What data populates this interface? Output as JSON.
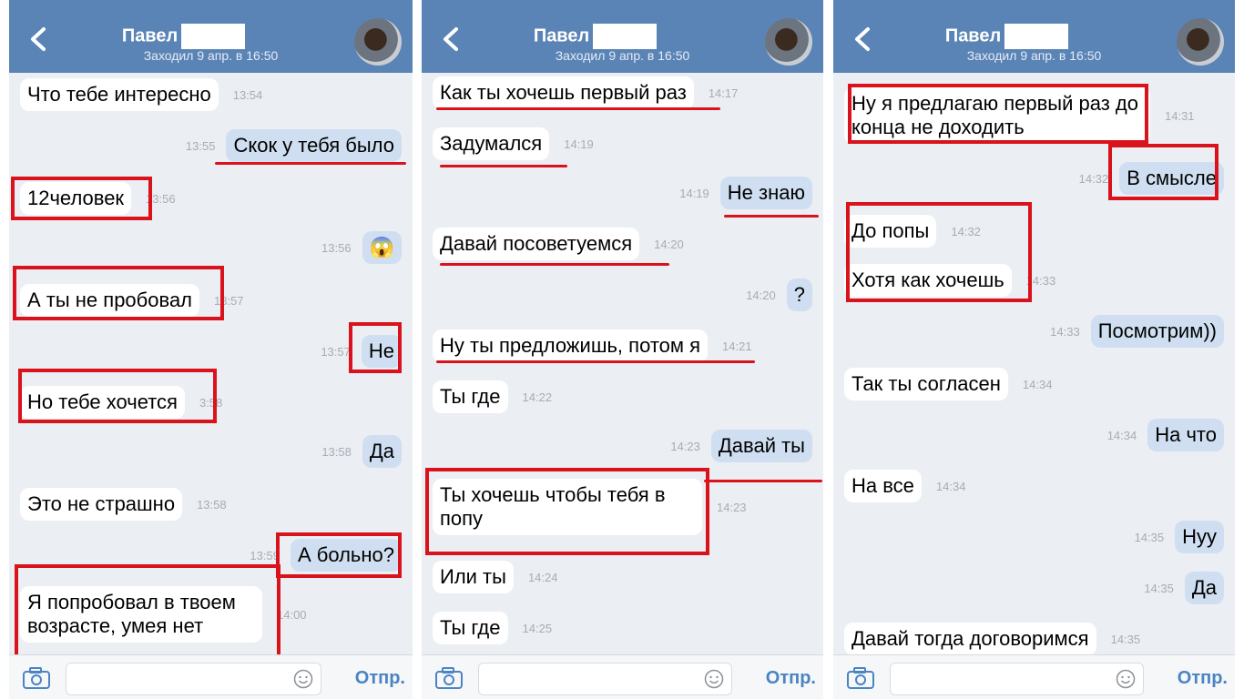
{
  "header": {
    "name": "Павел",
    "status": "Заходил 9 апр. в 16:50"
  },
  "input": {
    "placeholder": "",
    "send_label": "Отпр."
  },
  "panels": [
    {
      "messages": [
        {
          "dir": "in",
          "text": "Что тебе интересно",
          "time": "13:54"
        },
        {
          "dir": "out",
          "text": "Скок у тебя было",
          "time": "13:55"
        },
        {
          "dir": "in",
          "text": "12человек",
          "time": "13:56"
        },
        {
          "dir": "out",
          "text": "😱",
          "time": "13:56"
        },
        {
          "dir": "in",
          "text": "А ты не пробовал",
          "time": "13:57"
        },
        {
          "dir": "out",
          "text": "Не",
          "time": "13:57"
        },
        {
          "dir": "in",
          "text": "Но тебе хочется",
          "time": "3:58"
        },
        {
          "dir": "out",
          "text": "Да",
          "time": "13:58"
        },
        {
          "dir": "in",
          "text": "Это не страшно",
          "time": "13:58"
        },
        {
          "dir": "out",
          "text": "А больно?",
          "time": "13:59"
        },
        {
          "dir": "in",
          "text": "Я попробовал в твоем возрасте, умея нет",
          "time": "14:00"
        }
      ]
    },
    {
      "messages": [
        {
          "dir": "in",
          "text": "Как ты хочешь первый раз",
          "time": "14:17"
        },
        {
          "dir": "in",
          "text": "Задумался",
          "time": "14:19"
        },
        {
          "dir": "out",
          "text": "Не знаю",
          "time": "14:19"
        },
        {
          "dir": "in",
          "text": "Давай посоветуемся",
          "time": "14:20"
        },
        {
          "dir": "out",
          "text": "?",
          "time": "14:20"
        },
        {
          "dir": "in",
          "text": "Ну ты предложишь, потом я",
          "time": "14:21"
        },
        {
          "dir": "in",
          "text": "Ты где",
          "time": "14:22"
        },
        {
          "dir": "out",
          "text": "Давай ты",
          "time": "14:23"
        },
        {
          "dir": "in",
          "text": "Ты хочешь чтобы тебя в попу",
          "time": "14:23"
        },
        {
          "dir": "in",
          "text": "Или ты",
          "time": "14:24"
        },
        {
          "dir": "in",
          "text": "Ты где",
          "time": "14:25"
        }
      ]
    },
    {
      "messages": [
        {
          "dir": "in",
          "text": "Ну я предлагаю первый раз до конца не доходить",
          "time": "14:31"
        },
        {
          "dir": "out",
          "text": "В смысле",
          "time": "14:32"
        },
        {
          "dir": "in",
          "text": "До попы",
          "time": "14:32"
        },
        {
          "dir": "in",
          "text": "Хотя как хочешь",
          "time": "14:33"
        },
        {
          "dir": "out",
          "text": "Посмотрим))",
          "time": "14:33"
        },
        {
          "dir": "in",
          "text": "Так ты согласен",
          "time": "14:34"
        },
        {
          "dir": "out",
          "text": "На что",
          "time": "14:34"
        },
        {
          "dir": "in",
          "text": "На все",
          "time": "14:34"
        },
        {
          "dir": "out",
          "text": "Нуу",
          "time": "14:35"
        },
        {
          "dir": "out",
          "text": "Да",
          "time": "14:35"
        },
        {
          "dir": "in",
          "text": "Давай тогда договоримся",
          "time": "14:35"
        }
      ]
    }
  ]
}
